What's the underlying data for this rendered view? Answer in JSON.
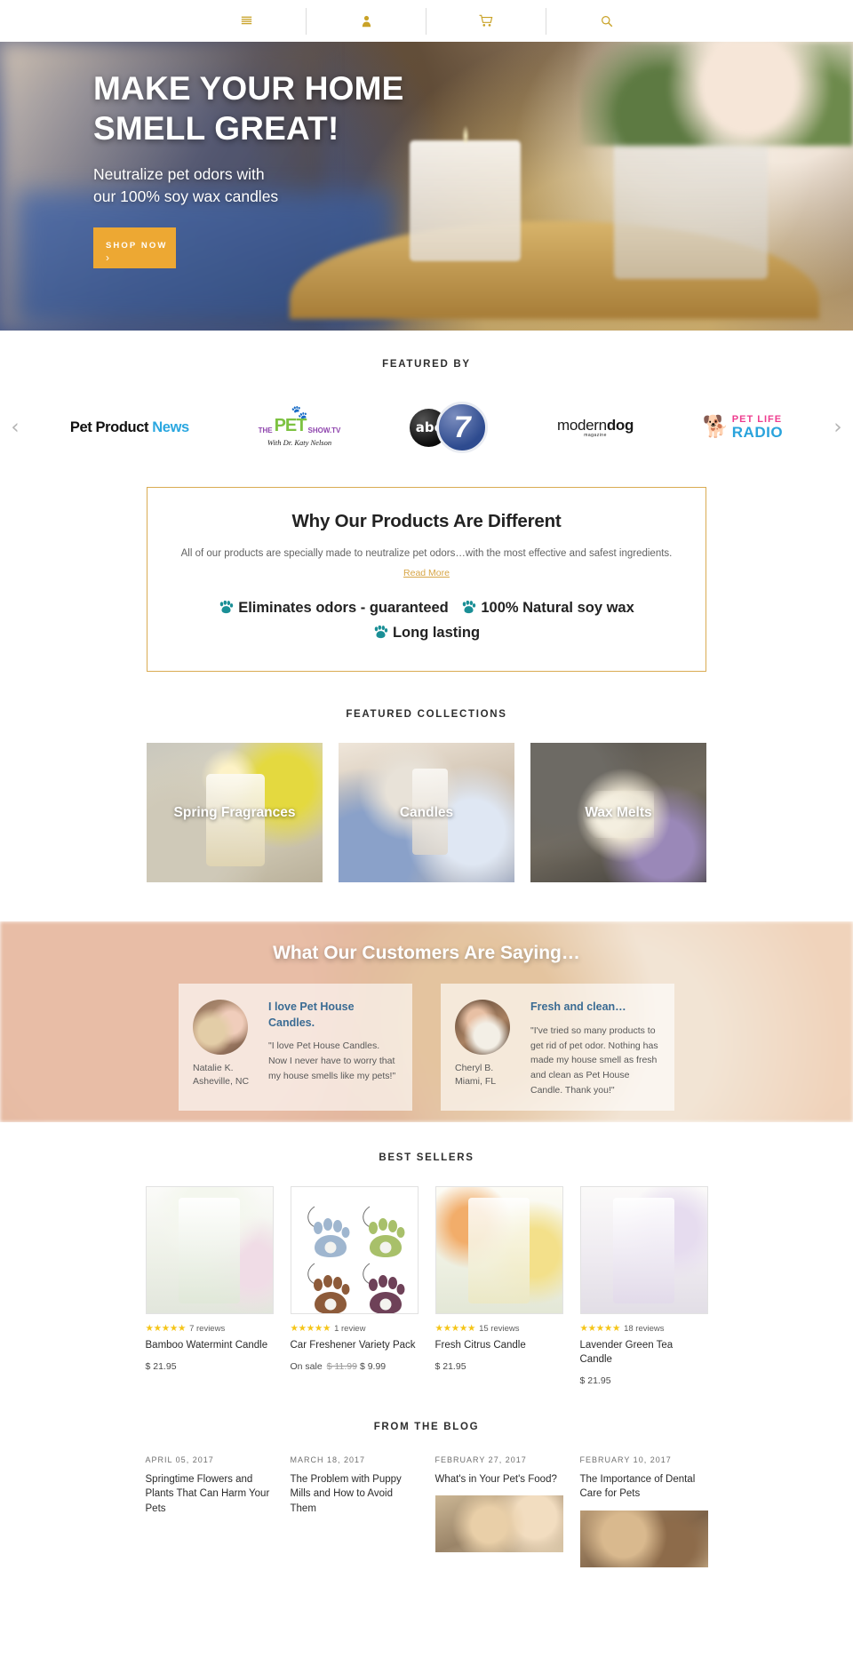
{
  "topnav": {
    "items": [
      {
        "name": "menu-icon",
        "label": "Menu"
      },
      {
        "name": "account-icon",
        "label": "Account"
      },
      {
        "name": "cart-icon",
        "label": "Cart"
      },
      {
        "name": "search-icon",
        "label": "Search"
      }
    ],
    "icon_color": "#c9a227"
  },
  "hero": {
    "title_line1": "MAKE YOUR HOME",
    "title_line2": "SMELL GREAT!",
    "sub_line1": "Neutralize pet odors with",
    "sub_line2": "our 100% soy wax candles",
    "button_label": "SHOP NOW",
    "button_arrow": "›",
    "button_color": "#eda833"
  },
  "featured_by": {
    "heading": "FEATURED BY",
    "prev_arrow": "‹",
    "next_arrow": "›",
    "logos": [
      {
        "name": "pet-product-news",
        "part1": "Pet Product ",
        "part2": "News"
      },
      {
        "name": "the-pet-show-tv",
        "the": "THE",
        "pet": "PET",
        "show": "SHOW.TV",
        "sub": "With Dr. Katy Nelson"
      },
      {
        "name": "abc-7",
        "abc": "abc",
        "seven": "7"
      },
      {
        "name": "moderndog-magazine",
        "modern": "modern",
        "dog": "dog",
        "mag": "magazine"
      },
      {
        "name": "pet-life-radio",
        "line1": "PET LIFE",
        "line2": "RADIO"
      }
    ]
  },
  "why_different": {
    "title": "Why Our Products Are Different",
    "text": "All of our products are specially made to neutralize pet odors…with the most effective and safest ingredients.",
    "read_more": "Read More",
    "bullets": [
      "Eliminates odors - guaranteed",
      "100% Natural soy wax",
      "Long lasting"
    ],
    "border_color": "#d9ab52",
    "paw_color": "#1a8f96",
    "link_color": "#d7a546"
  },
  "featured_collections": {
    "heading": "FEATURED COLLECTIONS",
    "cards": [
      {
        "label": "Spring Fragrances"
      },
      {
        "label": "Candles"
      },
      {
        "label": "Wax Melts"
      }
    ]
  },
  "testimonials": {
    "heading": "What Our Customers Are Saying…",
    "items": [
      {
        "title": "I love Pet House Candles.",
        "quote": "\"I love Pet House Candles. Now I never have to worry that my house smells like my pets!\"",
        "name": "Natalie K.",
        "location": "Asheville, NC"
      },
      {
        "title": "Fresh and clean…",
        "quote": "\"I've tried so many products to get rid of pet odor. Nothing has made my house smell as fresh and clean as Pet House Candle. Thank you!\"",
        "name": "Cheryl B.",
        "location": "Miami, FL"
      }
    ]
  },
  "best_sellers": {
    "heading": "BEST SELLERS",
    "products": [
      {
        "title": "Bamboo Watermint Candle",
        "stars": "★★★★★",
        "reviews": "7 reviews",
        "price": "$ 21.95",
        "on_sale": false
      },
      {
        "title": "Car Freshener Variety Pack",
        "stars": "★★★★★",
        "reviews": "1 review",
        "sale_label": "On sale",
        "old_price": "$ 11.99",
        "price": "$ 9.99",
        "on_sale": true
      },
      {
        "title": "Fresh Citrus Candle",
        "stars": "★★★★★",
        "reviews": "15 reviews",
        "price": "$ 21.95",
        "on_sale": false
      },
      {
        "title": "Lavender Green Tea Candle",
        "stars": "★★★★★",
        "reviews": "18 reviews",
        "price": "$ 21.95",
        "on_sale": false
      }
    ],
    "star_color": "#f5c518"
  },
  "blog": {
    "heading": "FROM THE BLOG",
    "posts": [
      {
        "date": "APRIL 05, 2017",
        "title": "Springtime Flowers and Plants That Can Harm Your Pets",
        "has_image": false
      },
      {
        "date": "MARCH 18, 2017",
        "title": "The Problem with Puppy Mills and How to Avoid Them",
        "has_image": false
      },
      {
        "date": "FEBRUARY 27, 2017",
        "title": "What's in Your Pet's Food?",
        "has_image": true
      },
      {
        "date": "FEBRUARY 10, 2017",
        "title": "The Importance of Dental Care for Pets",
        "has_image": true
      }
    ]
  }
}
